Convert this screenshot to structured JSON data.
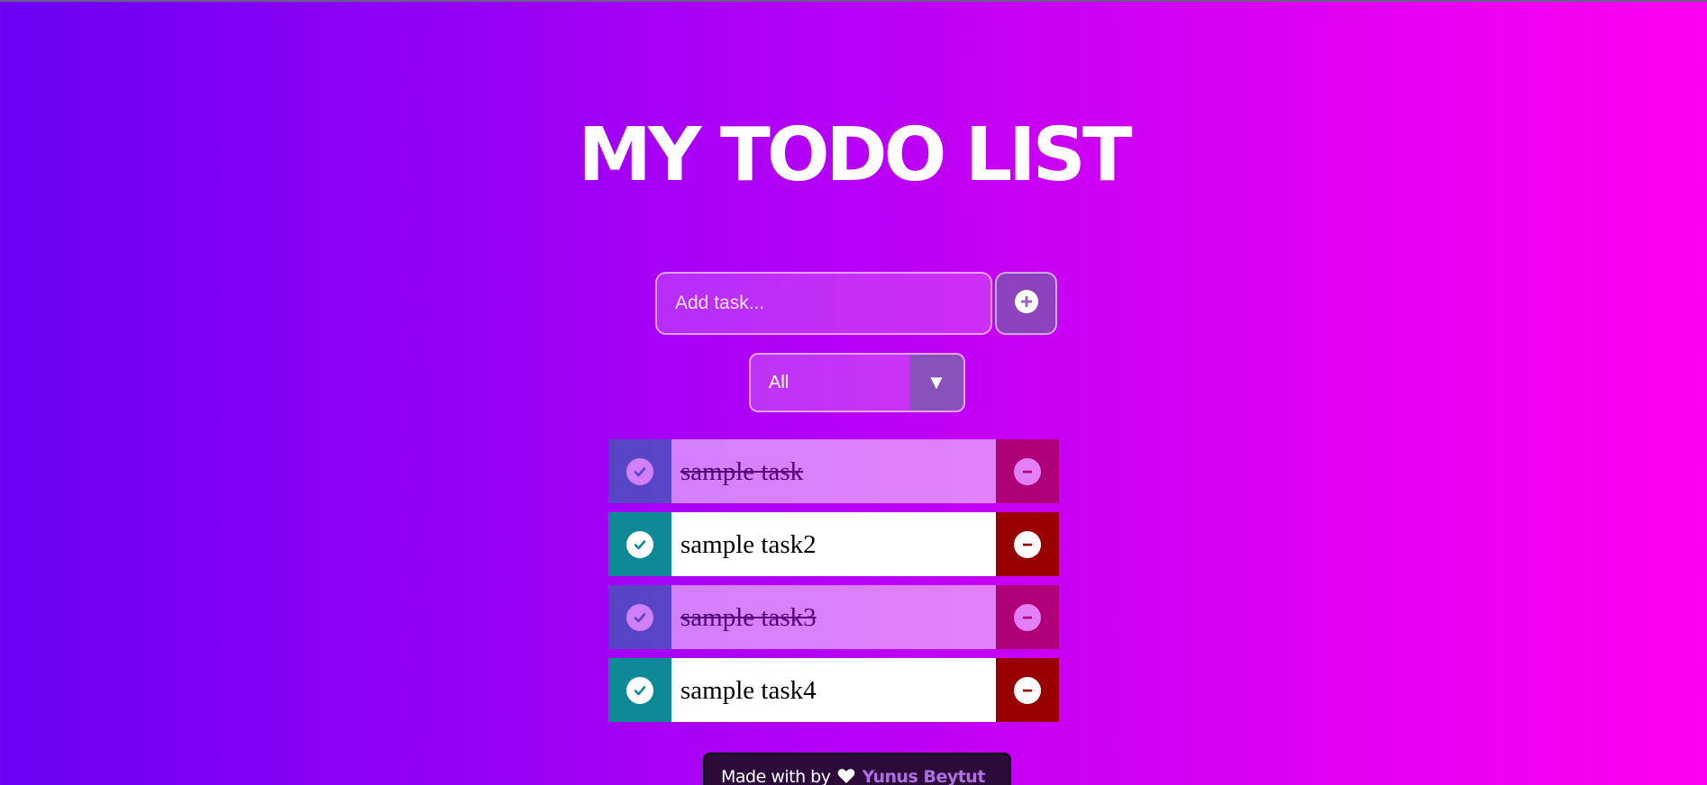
{
  "header": {
    "title": "MY TODO LIST"
  },
  "form": {
    "input_placeholder": "Add task...",
    "input_value": "",
    "add_icon": "plus-circle-icon",
    "filter_selected": "All",
    "filter_arrow": "▼"
  },
  "todos": [
    {
      "text": "sample task",
      "completed": true
    },
    {
      "text": "sample task2",
      "completed": false
    },
    {
      "text": "sample task3",
      "completed": true
    },
    {
      "text": "sample task4",
      "completed": false
    }
  ],
  "footer": {
    "made_with": "Made with by",
    "heart_icon": "heart-icon",
    "author": "Yunus Beytut"
  },
  "colors": {
    "gradient_start": "#6a00f4",
    "gradient_mid": "#b800f6",
    "gradient_end": "#ff00f0",
    "check_bg": "#0e8a96",
    "trash_bg": "#990000"
  }
}
